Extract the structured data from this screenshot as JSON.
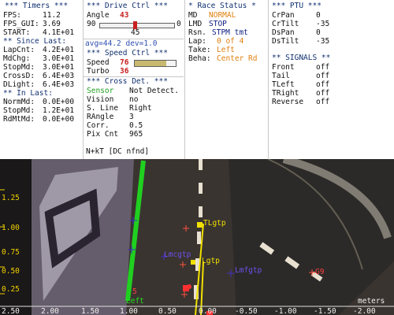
{
  "timers": {
    "title": "*** Timers ***",
    "fps_label": "FPS:",
    "fps": "11.2",
    "fps_gui_label": "FPS_GUI:",
    "fps_gui": "3.69",
    "start_label": "START:",
    "start": "4.1E+01",
    "since_last_title": "** Since Last:",
    "since_last": [
      {
        "label": "LapCnt:",
        "value": "4.2E+01"
      },
      {
        "label": "MdChg:",
        "value": "3.0E+01"
      },
      {
        "label": "StopMd:",
        "value": "3.0E+01"
      },
      {
        "label": "CrossD:",
        "value": "6.4E+03"
      },
      {
        "label": "DLight:",
        "value": "6.4E+03"
      }
    ],
    "in_last_title": "** In Last:",
    "in_last": [
      {
        "label": "NormMd:",
        "value": "0.0E+00"
      },
      {
        "label": "StopMd:",
        "value": "1.2E+01"
      },
      {
        "label": "RdMtMd:",
        "value": "0.0E+00"
      }
    ]
  },
  "drive_ctrl": {
    "title": "*** Drive Ctrl ***",
    "angle_label": "Angle",
    "angle": "43",
    "slider_min": "90",
    "slider_max": "0",
    "slider_fraction": 0.47,
    "slider_value": "45",
    "avg_text": "avg=44.2 dev=1.0",
    "speed_title": "*** Speed Ctrl ***",
    "speed_label": "Speed",
    "speed": "76",
    "speed_fraction": 0.76,
    "turbo_label": "Turbo",
    "turbo": "36",
    "cross_title": "*** Cross Det. ***",
    "cross": [
      {
        "label": "Sensor",
        "value": "Not Detect."
      },
      {
        "label": "Vision",
        "value": "no"
      },
      {
        "label": "S. Line",
        "value": "Right"
      },
      {
        "label": "RAngle",
        "value": "3"
      },
      {
        "label": "Corr.",
        "value": "0.5"
      },
      {
        "label": "Pix Cnt",
        "value": "965"
      }
    ],
    "nkt_text": "N+kT [DC nfnd]"
  },
  "race_status": {
    "title": "* Race Status *",
    "md_label": "MD",
    "md": "NORMAL",
    "lmd_label": "LMD",
    "lmd": "STOP",
    "rsn_label": "Rsn.",
    "rsn": "STPM tmt",
    "lap_label": "Lap:",
    "lap": "0 of 4",
    "take_label": "Take:",
    "take": "Left",
    "beha_label": "Beha:",
    "beha": "Center Rd"
  },
  "ptu": {
    "title": "*** PTU ***",
    "rows": [
      {
        "label": "CrPan",
        "value": "0"
      },
      {
        "label": "CrTilt",
        "value": "-35"
      },
      {
        "label": "DsPan",
        "value": "0"
      },
      {
        "label": "DsTilt",
        "value": "-35"
      }
    ],
    "signals_title": "** SIGNALS **",
    "signals": [
      {
        "label": "Front",
        "value": "off"
      },
      {
        "label": "Tail",
        "value": "off"
      },
      {
        "label": "TLeft",
        "value": "off"
      },
      {
        "label": "TRight",
        "value": "off"
      },
      {
        "label": "Reverse",
        "value": "off"
      }
    ]
  },
  "camera": {
    "y_ticks": [
      "1.25",
      "1.00",
      "0.75",
      "0.50",
      "0.25",
      "0.00"
    ],
    "x_ticks": [
      "2.50",
      "2.00",
      "1.50",
      "1.00",
      "0.50",
      "0.00",
      "-0.50",
      "-1.00",
      "-1.50",
      "-2.00"
    ],
    "x_unit": "meters",
    "markers": {
      "left_line": "Left",
      "left_num": "5",
      "lgtp": "Lgtp",
      "tlgtp": "TLgtp",
      "lmcgtp": "Lmcgtp",
      "lmfgtp": "Lmfgtp",
      "g9": "G9"
    },
    "colors": {
      "accent_yellow": "#f0d000",
      "green_line": "#20d020",
      "red_marker": "#ff3030",
      "purple": "#7040e0"
    }
  }
}
